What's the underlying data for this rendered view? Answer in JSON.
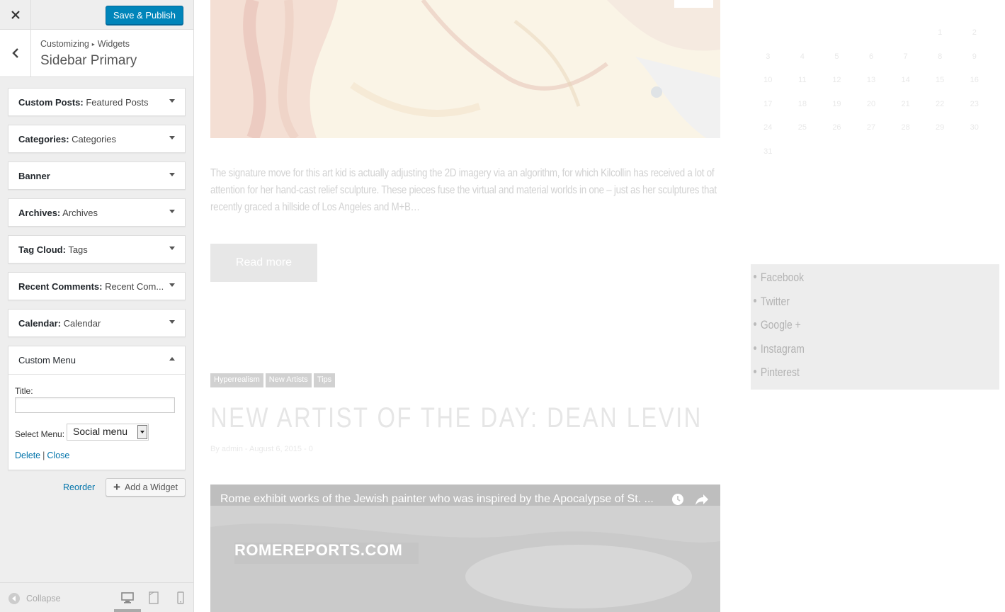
{
  "colors": {
    "accent": "#0085ba",
    "link": "#0073aa",
    "panel": "#eeeeee"
  },
  "customizer": {
    "close_icon": "close-icon",
    "publish_label": "Save & Publish",
    "breadcrumb": {
      "root": "Customizing",
      "current": "Widgets"
    },
    "section_title": "Sidebar Primary",
    "widgets": [
      {
        "type": "Custom Posts:",
        "name": "Featured Posts"
      },
      {
        "type": "Categories:",
        "name": "Categories"
      },
      {
        "type": "Banner",
        "name": ""
      },
      {
        "type": "Archives:",
        "name": "Archives"
      },
      {
        "type": "Tag Cloud:",
        "name": "Tags"
      },
      {
        "type": "Recent Comments:",
        "name": "Recent Com..."
      },
      {
        "type": "Calendar:",
        "name": "Calendar"
      }
    ],
    "open_widget": {
      "type": "Custom Menu",
      "title_label": "Title:",
      "title_value": "",
      "select_label": "Select Menu:",
      "select_value": "Social menu",
      "delete_label": "Delete",
      "separator": "|",
      "close_label": "Close"
    },
    "reorder_label": "Reorder",
    "add_widget_label": "Add a Widget",
    "collapse_label": "Collapse"
  },
  "preview": {
    "excerpt": "The signature move for this art kid is actually adjusting the 2D imagery via an algorithm, for which Kilcollin has received a lot of attention for her hand-cast relief sculpture. These pieces fuse the virtual and material worlds in one – just as her sculptures that recently graced a hillside of Los Angeles and M+B…",
    "read_more": "Read more",
    "tags": [
      "Hyperrealism",
      "New Artists",
      "Tips"
    ],
    "post_title": "NEW ARTIST OF THE DAY: DEAN LEVIN",
    "post_meta": "By admin - August 6, 2015 - 0",
    "video_title": "Rome exhibit works of the Jewish painter who was inspired by the Apocalypse of St. ...",
    "video_watermark": "ROMEREPORTS.COM",
    "calendar_rows": [
      [
        "",
        "",
        "",
        "",
        "",
        "1",
        "2"
      ],
      [
        "3",
        "4",
        "5",
        "6",
        "7",
        "8",
        "9"
      ],
      [
        "10",
        "11",
        "12",
        "13",
        "14",
        "15",
        "16"
      ],
      [
        "17",
        "18",
        "19",
        "20",
        "21",
        "22",
        "23"
      ],
      [
        "24",
        "25",
        "26",
        "27",
        "28",
        "29",
        "30"
      ],
      [
        "31",
        "",
        "",
        "",
        "",
        "",
        ""
      ]
    ],
    "social_links": [
      "Facebook",
      "Twitter",
      "Google +",
      "Instagram",
      "Pinterest"
    ]
  }
}
